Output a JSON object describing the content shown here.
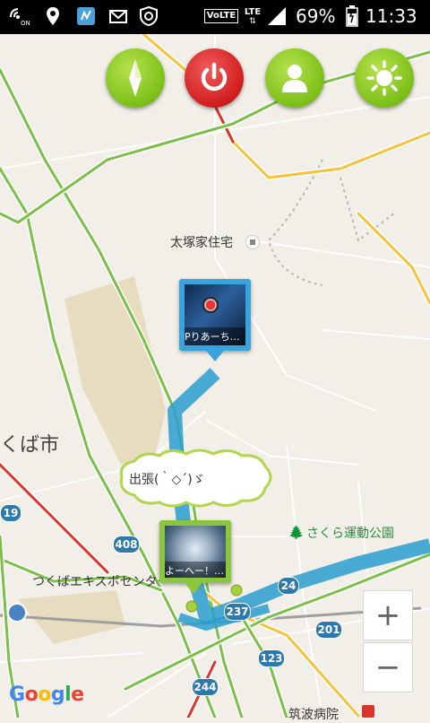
{
  "status_bar": {
    "volte": "VoLTE",
    "lte": "LTE",
    "battery": "69%",
    "time": "11:33"
  },
  "toolbar": {
    "compass_icon": "compass-icon",
    "power_icon": "power-icon",
    "profile_icon": "person-icon",
    "brightness_icon": "sun-icon"
  },
  "map": {
    "places": {
      "taizukayajutaku": "太塚家住宅",
      "tsukuba_city": "くば市",
      "sakura_park": "さくら運動公園",
      "tsukuba_expo": "つくばエキスポセンター",
      "hospital": "筑波病院"
    },
    "routes": [
      "19",
      "408",
      "24",
      "237",
      "201",
      "123",
      "244"
    ],
    "markers": [
      {
        "label": "Pりあーち…"
      },
      {
        "label": "よーへー！…"
      }
    ],
    "speech_bubble": "出張(｀◇´)ゞ",
    "attribution": "Google"
  },
  "zoom": {
    "plus": "+",
    "minus": "−"
  }
}
